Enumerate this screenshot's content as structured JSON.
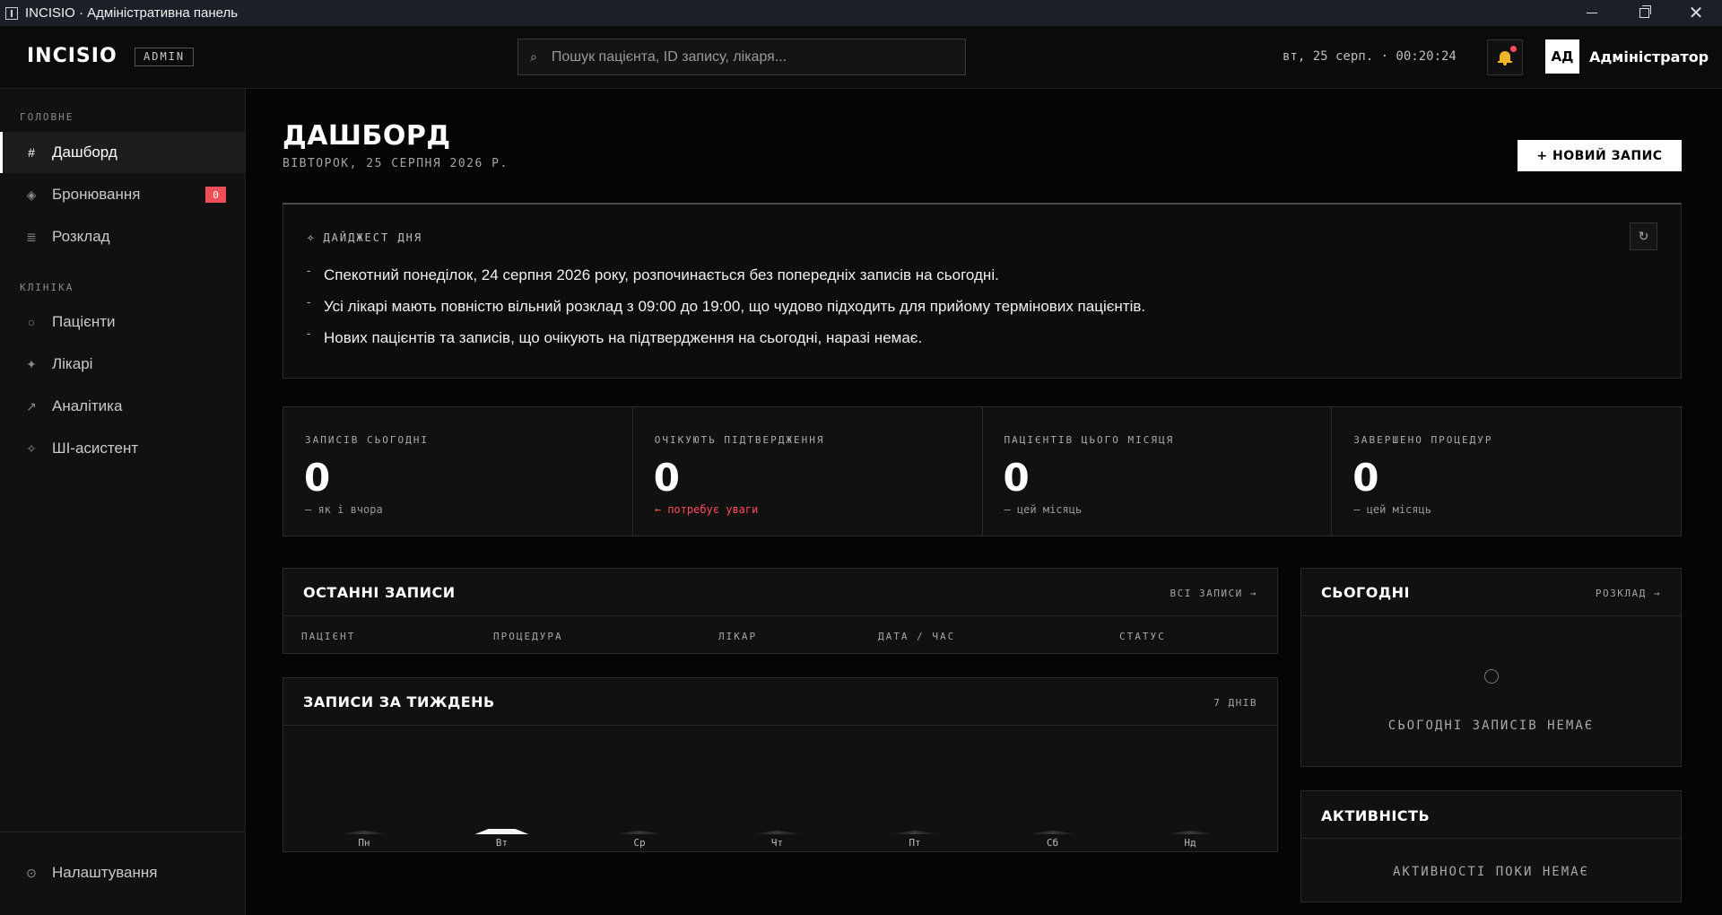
{
  "window": {
    "title": "INCISIO · Адміністративна панель"
  },
  "header": {
    "logo": "INCISIO",
    "tag": "ADMIN",
    "search_placeholder": "Пошук пацієнта, ID запису, лікаря...",
    "clock": "вт, 25 серп. · 00:20:24",
    "avatar": "АД",
    "user": "Адміністратор"
  },
  "sidebar": {
    "sections": [
      {
        "title": "ГОЛОВНЕ"
      },
      {
        "title": "КЛІНІКА"
      }
    ],
    "items": [
      {
        "icon": "#",
        "label": "Дашборд",
        "icon_name": "hash-icon",
        "active": true
      },
      {
        "icon": "◈",
        "label": "Бронювання",
        "icon_name": "diamond-icon",
        "badge": "0"
      },
      {
        "icon": "≣",
        "label": "Розклад",
        "icon_name": "list-icon"
      },
      {
        "icon": "○",
        "label": "Пацієнти",
        "icon_name": "circle-icon"
      },
      {
        "icon": "✦",
        "label": "Лікарі",
        "icon_name": "star-icon"
      },
      {
        "icon": "↗",
        "label": "Аналітика",
        "icon_name": "arrow-up-right-icon"
      },
      {
        "icon": "✧",
        "label": "ШІ-асистент",
        "icon_name": "sparkle-icon"
      }
    ],
    "settings": {
      "icon": "⊙",
      "label": "Налаштування",
      "icon_name": "settings-icon"
    }
  },
  "main": {
    "title": "ДАШБОРД",
    "date": "ВІВТОРОК, 25 СЕРПНЯ 2026 Р.",
    "new_button": "+ НОВИЙ ЗАПИС"
  },
  "digest": {
    "title": "ДАЙДЖЕСТ ДНЯ",
    "items": [
      "Спекотний понеділок, 24 серпня 2026 року, розпочинається без попередніх записів на сьогодні.",
      "Усі лікарі мають повністю вільний розклад з 09:00 до 19:00, що чудово підходить для прийому термінових пацієнтів.",
      "Нових пацієнтів та записів, що очікують на підтвердження на сьогодні, наразі немає."
    ]
  },
  "stats": [
    {
      "label": "ЗАПИСІВ СЬОГОДНІ",
      "value": "0",
      "note": "— як і вчора"
    },
    {
      "label": "ОЧІКУЮТЬ ПІДТВЕРДЖЕННЯ",
      "value": "0",
      "note": "← потребує уваги",
      "alert": true
    },
    {
      "label": "ПАЦІЄНТІВ ЦЬОГО МІСЯЦЯ",
      "value": "0",
      "note": "— цей місяць"
    },
    {
      "label": "ЗАВЕРШЕНО ПРОЦЕДУР",
      "value": "0",
      "note": "— цей місяць"
    }
  ],
  "recent": {
    "title": "ОСТАННІ ЗАПИСИ",
    "link": "ВСІ ЗАПИСИ →",
    "columns": [
      "ПАЦІЄНТ",
      "ПРОЦЕДУРА",
      "ЛІКАР",
      "ДАТА / ЧАС",
      "СТАТУС"
    ]
  },
  "week": {
    "title": "ЗАПИСИ ЗА ТИЖДЕНЬ",
    "link": "7 ДНІВ"
  },
  "chart_data": {
    "type": "bar",
    "categories": [
      "Пн",
      "Вт",
      "Ср",
      "Чт",
      "Пт",
      "Сб",
      "Нд"
    ],
    "values": [
      0,
      0,
      0,
      0,
      0,
      0,
      0
    ],
    "highlight": "Вт"
  },
  "today": {
    "title": "СЬОГОДНІ",
    "link": "РОЗКЛАД →",
    "empty": "СЬОГОДНІ ЗАПИСІВ НЕМАЄ"
  },
  "activity": {
    "title": "АКТИВНІСТЬ",
    "empty": "АКТИВНОСТІ ПОКИ НЕМАЄ"
  },
  "colors": {
    "accent": "#ffffff",
    "alert": "#ff4d5a",
    "bell": "#f0b52a",
    "badge": "#ee4e56"
  }
}
